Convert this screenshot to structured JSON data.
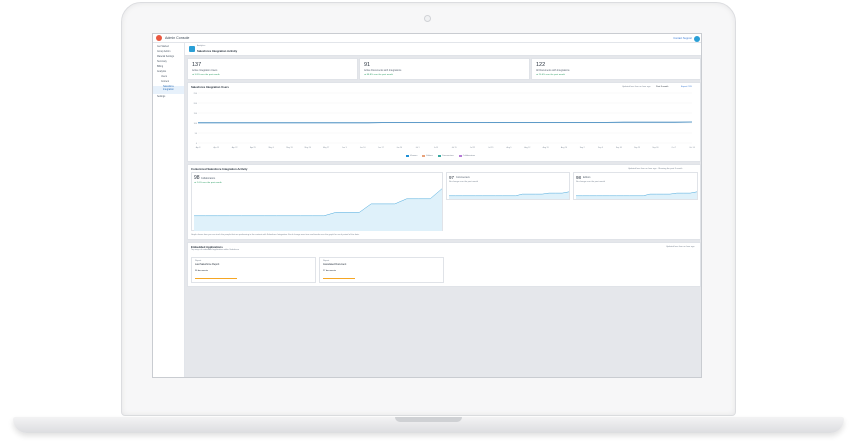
{
  "app": {
    "title": "Admin Console",
    "top_link": "Contact Support"
  },
  "sidebar": {
    "items": [
      "Get Started",
      "Group Admin",
      "Material Settings",
      "Summary",
      "Billing",
      "Analytics",
      "Users",
      "Content",
      "Salesforce Integration",
      "Settings"
    ],
    "active_index": 8
  },
  "page": {
    "breadcrumb": "Analytics",
    "title": "Salesforce Integration Activity"
  },
  "stats": [
    {
      "value": "137",
      "label": "Active Integration Users",
      "change": "▲ 5.8% over the past month"
    },
    {
      "value": "91",
      "label": "Active Documents with Integrations",
      "change": "▲ 88.8% over the past month"
    },
    {
      "value": "122",
      "label": "All Documents with Integrations",
      "change": "▲ 20.6% over the past month"
    }
  ],
  "users_chart": {
    "heading": "Salesforce Integration Users",
    "updated": "Updated less than an hour ago",
    "range": "Past 3 month",
    "export": "Export CSV",
    "legend": [
      "Viewers",
      "Editors",
      "Commenters",
      "Collaborators"
    ],
    "legend_colors": [
      "#1f8fd6",
      "#e8a27a",
      "#3aa8a0",
      "#b57ad6"
    ],
    "chart_data": {
      "type": "line",
      "series": [
        {
          "name": "Viewers",
          "values": [
            101,
            101,
            101,
            101,
            101,
            101,
            101,
            101,
            101,
            101,
            101,
            102,
            102,
            102,
            102,
            102,
            102,
            102,
            103,
            103,
            103,
            103,
            103,
            103,
            103,
            104,
            104,
            104,
            104,
            105
          ]
        }
      ],
      "ylim": [
        0,
        250
      ],
      "x_ticks": [
        "Apr 8",
        "Apr 15",
        "Apr 22",
        "Apr 29",
        "May 6",
        "May 13",
        "May 20",
        "May 27",
        "Jun 3",
        "Jun 10",
        "Jun 17",
        "Jun 24",
        "Jul 1",
        "Jul 8",
        "Jul 15",
        "Jul 22",
        "Jul 29",
        "Aug 5",
        "Aug 12",
        "Aug 19",
        "Aug 26",
        "Sep 2",
        "Sep 9",
        "Sep 16",
        "Sep 23",
        "Sep 30",
        "Oct 7",
        "Oct 14"
      ]
    }
  },
  "collab": {
    "heading": "Content-led Salesforce Integration Activity",
    "updated": "Updated less than an hour ago · Showing the past 3 month",
    "main": {
      "value": "98",
      "label": "Collaborators",
      "change": "▲ 2.6% over the past month",
      "values": [
        18,
        18,
        18,
        18,
        18,
        18,
        18,
        18,
        18,
        18,
        18,
        18,
        22,
        22,
        22,
        32,
        32,
        32,
        38,
        38,
        38,
        50
      ]
    },
    "commenters": {
      "value": "97",
      "label": "Commenters",
      "change": "No change over the past month",
      "values": [
        10,
        10,
        10,
        10,
        10,
        10,
        10,
        10,
        10,
        10,
        10,
        15,
        15,
        15,
        15,
        18,
        18,
        18,
        22
      ]
    },
    "editors": {
      "value": "98",
      "label": "Editors",
      "change": "No change over the past month",
      "values": [
        10,
        10,
        10,
        10,
        10,
        10,
        10,
        10,
        10,
        10,
        10,
        15,
        15,
        15,
        15,
        18,
        18,
        18,
        22
      ]
    },
    "note": "Graph shows how you can track the people that are performing in the content with Salesforce Integration. Each change over time and trends over the graph for each period of the data."
  },
  "embedded": {
    "heading": "Embedded Applications",
    "sub": "Top ways of embedded application within Salesforce",
    "updated": "Updated less than an hour ago",
    "cards": [
      {
        "tag": "Report",
        "title": "Last Salesforce Report",
        "count": "36 documents",
        "bar": 0.35
      },
      {
        "tag": "Report",
        "title": "Associated Document",
        "count": "27 documents",
        "bar": 0.27
      }
    ]
  }
}
